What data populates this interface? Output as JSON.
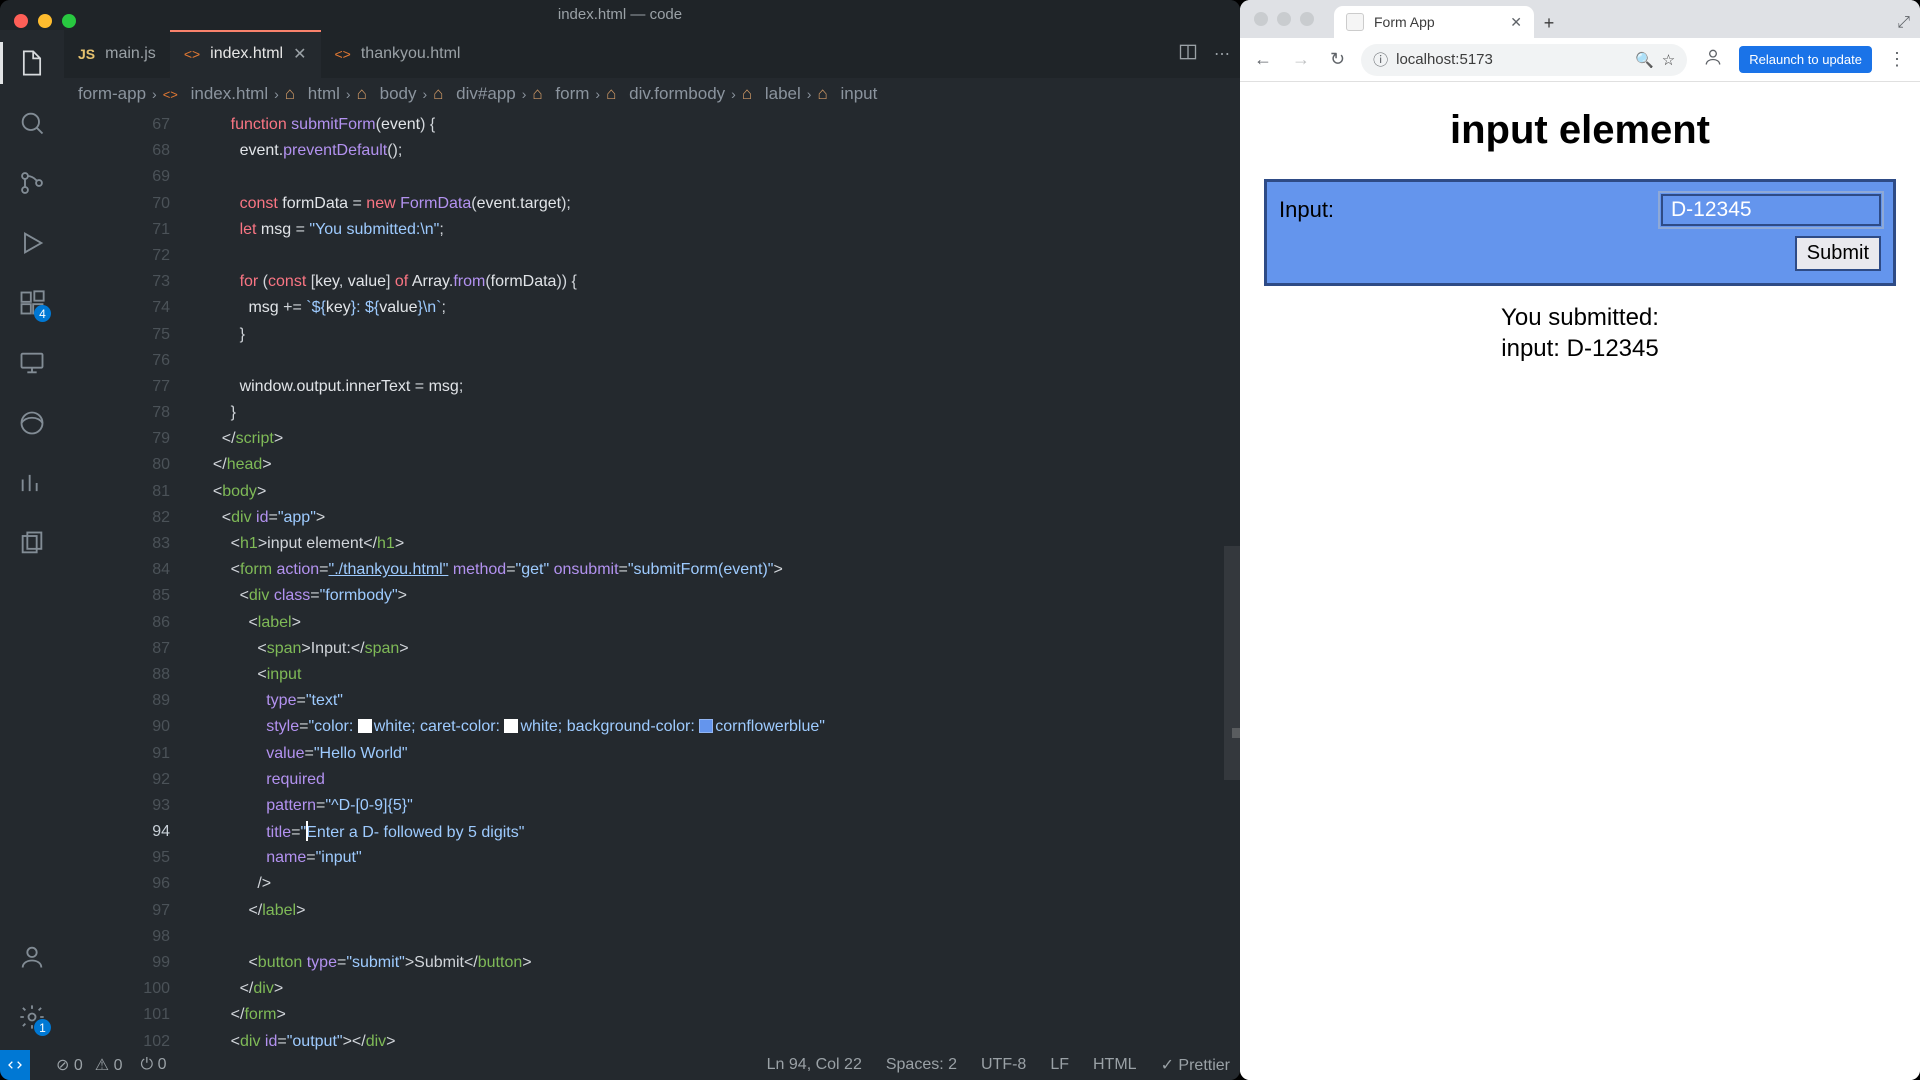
{
  "vscode": {
    "traffic": {
      "close": "#fe5f57",
      "min": "#febc2e",
      "max": "#28c840"
    },
    "window_title": "index.html — code",
    "tabs": [
      {
        "icon_color": "#e6c26f",
        "icon_label": "JS",
        "label": "main.js",
        "active": false,
        "close": false
      },
      {
        "icon_color": "#e37933",
        "icon_label": "<>",
        "label": "index.html",
        "active": true,
        "close": true
      },
      {
        "icon_color": "#e37933",
        "icon_label": "<>",
        "label": "thankyou.html",
        "active": false,
        "close": false
      }
    ],
    "breadcrumbs": [
      "form-app",
      "index.html",
      "html",
      "body",
      "div#app",
      "form",
      "div.formbody",
      "label",
      "input"
    ],
    "activity_badges": {
      "extensions": "4",
      "settings": "1"
    },
    "line_start": 67,
    "current_line": 94,
    "status": {
      "errors": "0",
      "warnings": "0",
      "ports": "0",
      "cursor": "Ln 94, Col 22",
      "spaces": "Spaces: 2",
      "encoding": "UTF-8",
      "eol": "LF",
      "lang": "HTML",
      "formatter": "Prettier"
    }
  },
  "code": {
    "l67": {
      "kw": "function",
      "fn": "submitForm",
      "args": "event"
    },
    "l68": {
      "a": "event",
      "b": "preventDefault"
    },
    "l70": {
      "kw": "const",
      "v": "formData",
      "nw": "new",
      "cls": "FormData",
      "arg": "event",
      "p": "target"
    },
    "l71": {
      "kw": "let",
      "v": "msg",
      "s": "\"You submitted:\\n\""
    },
    "l73": {
      "for": "for",
      "const": "const",
      "k": "key",
      "val": "value",
      "of": "of",
      "arr": "Array",
      "from": "from",
      "fd": "formData"
    },
    "l74": {
      "v": "msg",
      "k": "key",
      "val": "value"
    },
    "l77": {
      "a": "window",
      "b": "output",
      "c": "innerText",
      "d": "msg"
    },
    "l79": "script",
    "l80": "head",
    "l81": "body",
    "l82": {
      "tag": "div",
      "attr": "id",
      "val": "\"app\""
    },
    "l83": {
      "tag": "h1",
      "text": "input element"
    },
    "l84": {
      "tag": "form",
      "action": "\"./thankyou.html\"",
      "method": "\"get\"",
      "onsubmit": "\"submitForm(event)\""
    },
    "l85": {
      "tag": "div",
      "attr": "class",
      "val": "\"formbody\""
    },
    "l86": "label",
    "l87": {
      "tag": "span",
      "text": "Input:"
    },
    "l88": "input",
    "l89": {
      "a": "type",
      "v": "\"text\""
    },
    "l90": {
      "a": "style",
      "p1": "color",
      "c1": "white",
      "p2": "caret-color",
      "c2": "white",
      "p3": "background-color",
      "c3": "cornflowerblue"
    },
    "l91": {
      "a": "value",
      "v": "\"Hello World\""
    },
    "l92": "required",
    "l93": {
      "a": "pattern",
      "v": "\"^D-[0-9]{5}\""
    },
    "l94": {
      "a": "title",
      "v": "Enter a D- followed by 5 digits"
    },
    "l95": {
      "a": "name",
      "v": "\"input\""
    },
    "l97": "label",
    "l99": {
      "tag": "button",
      "attr": "type",
      "val": "\"submit\"",
      "text": "Submit"
    },
    "l100": "div",
    "l101": "form",
    "l102": {
      "tag": "div",
      "attr": "id",
      "val": "\"output\""
    }
  },
  "browser": {
    "tab_title": "Form App",
    "url": "localhost:5173",
    "relaunch": "Relaunch to update",
    "page_title": "input element",
    "input_label": "Input:",
    "input_value": "D-12345",
    "submit": "Submit",
    "output_l1": "You submitted:",
    "output_l2": "input: D-12345"
  }
}
